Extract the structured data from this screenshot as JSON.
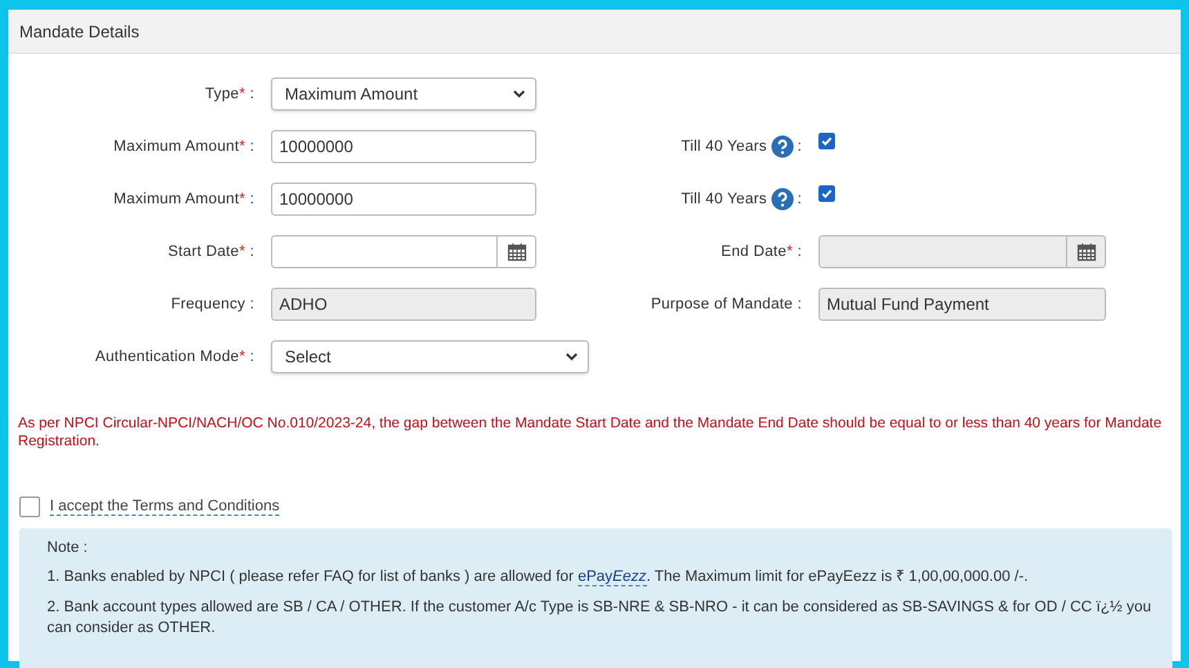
{
  "panel": {
    "title": "Mandate Details"
  },
  "rows": [
    {
      "left": {
        "label": "Type",
        "required_mark": "*",
        "separator": ":",
        "kind": "select",
        "value": "Maximum Amount",
        "disabled": false,
        "wide": false
      },
      "right": null
    },
    {
      "left": {
        "label": "Maximum Amount",
        "required_mark": "*",
        "separator": ":",
        "kind": "text",
        "value": "10000000",
        "disabled": false
      },
      "right": {
        "label": "Till 40 Years",
        "help": true,
        "separator": ":",
        "kind": "checkbox",
        "checked": true
      }
    },
    {
      "left": {
        "label": "Maximum Amount",
        "required_mark": "*",
        "separator": ":",
        "kind": "text",
        "value": "10000000",
        "disabled": false
      },
      "right": {
        "label": "Till 40 Years",
        "help": true,
        "separator": ":",
        "kind": "checkbox",
        "checked": true
      }
    },
    {
      "left": {
        "label": "Start Date",
        "required_mark": "*",
        "separator": ":",
        "kind": "date",
        "disabled": false
      },
      "right": {
        "label": "End Date",
        "required_mark": "*",
        "separator": ":",
        "kind": "date",
        "disabled": true
      }
    },
    {
      "left": {
        "label": "Frequency",
        "separator": ":",
        "kind": "text",
        "value": "ADHO",
        "disabled": true
      },
      "right": {
        "label": "Purpose of Mandate",
        "separator": ":",
        "kind": "text",
        "value": "Mutual Fund Payment",
        "disabled": true
      }
    },
    {
      "left": {
        "label": "Authentication Mode",
        "required_mark": "*",
        "separator": ":",
        "kind": "select",
        "value": "Select",
        "disabled": false,
        "wide": true
      },
      "right": null
    }
  ],
  "warning": "As per NPCI Circular-NPCI/NACH/OC No.010/2023-24, the gap between the Mandate Start Date and the Mandate End Date should be equal to or less than 40 years for Mandate Registration.",
  "terms": {
    "label": "I accept the Terms and Conditions",
    "checked": false
  },
  "note": {
    "title": "Note :",
    "items": [
      {
        "before": "1. Banks enabled by NPCI ( please refer FAQ for list of banks ) are allowed for",
        "link": "ePay",
        "link_italic": "Eezz",
        "after": ". The Maximum limit for ePayEezz is ₹ 1,00,00,000.00 /-."
      },
      {
        "before": "2. Bank account types allowed are SB / CA / OTHER. If the customer A/c Type is SB-NRE & SB-NRO - it can be considered as SB-SAVINGS & for OD / CC ï¿½ you can consider as OTHER."
      }
    ]
  }
}
